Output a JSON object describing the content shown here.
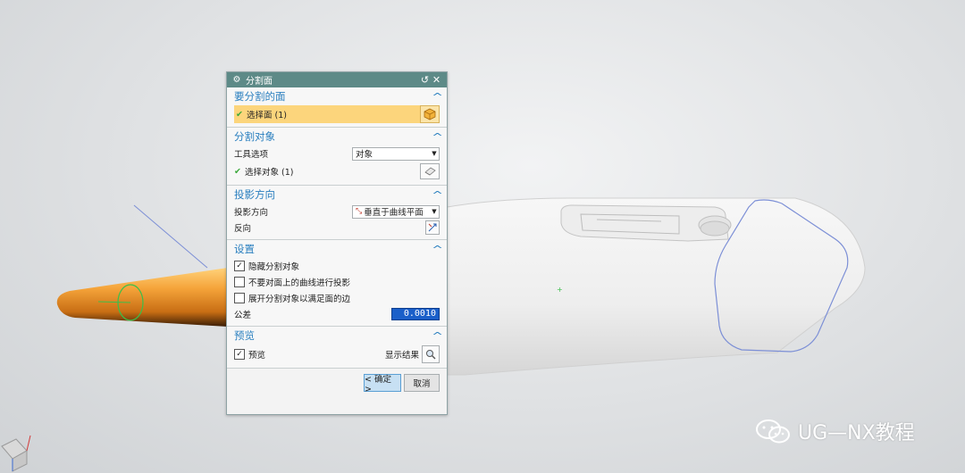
{
  "dialog": {
    "title": "分割面",
    "sections": {
      "faces": {
        "header": "要分割的面",
        "select_label": "选择面 (1)"
      },
      "objects": {
        "header": "分割对象",
        "tool_option_label": "工具选项",
        "tool_option_value": "对象",
        "select_label": "选择对象 (1)"
      },
      "projection": {
        "header": "投影方向",
        "direction_label": "投影方向",
        "direction_value": "垂直于曲线平面",
        "reverse_label": "反向"
      },
      "settings": {
        "header": "设置",
        "options": [
          {
            "label": "隐藏分割对象",
            "checked": true
          },
          {
            "label": "不要对面上的曲线进行投影",
            "checked": false
          },
          {
            "label": "展开分割对象以满足面的边",
            "checked": false
          }
        ],
        "tolerance_label": "公差",
        "tolerance_value": "0.0010"
      },
      "preview": {
        "header": "预览",
        "preview_label": "预览",
        "preview_checked": true,
        "show_result_label": "显示结果"
      }
    },
    "ok_label": "< 确定 >",
    "cancel_label": "取消"
  },
  "watermark": {
    "text": "UG—NX教程"
  },
  "colors": {
    "titlebar": "#5d8a87",
    "section_header": "#2a7fbf",
    "selection_highlight": "#fcd57c",
    "tolerance_bg": "#1a5fc9",
    "checkmark": "#3aa83a",
    "curve": "#7c8fd6",
    "orange_part": "#f2a63a"
  },
  "icons": {
    "title": "gear-icon",
    "reset": "reset-icon",
    "close": "close-icon",
    "face_select": "cube-select-icon",
    "object_select": "eraser-select-icon",
    "direction": "normal-direction-icon",
    "reverse": "reverse-direction-icon",
    "show_result": "magnifier-icon"
  }
}
